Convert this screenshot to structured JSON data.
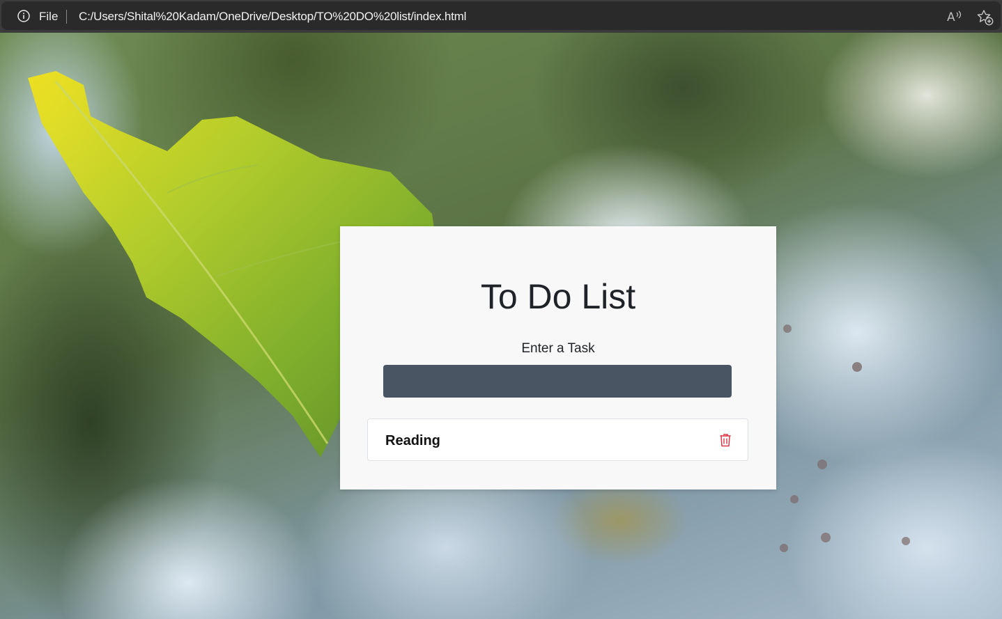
{
  "browser": {
    "scheme_label": "File",
    "url": "C:/Users/Shital%20Kadam/OneDrive/Desktop/TO%20DO%20list/index.html",
    "icons": {
      "site_info": "info-icon",
      "read_aloud": "read-aloud-icon",
      "favorites": "favorite-add-icon"
    }
  },
  "app": {
    "title": "To Do List",
    "input_label": "Enter a Task",
    "input": {
      "value": "",
      "placeholder": ""
    },
    "tasks": [
      {
        "text": "Reading",
        "action_icon": "trash-icon"
      }
    ],
    "colors": {
      "card_background": "#f8f8f8",
      "input_background": "#4a5563",
      "delete_icon": "#dc3545"
    }
  }
}
